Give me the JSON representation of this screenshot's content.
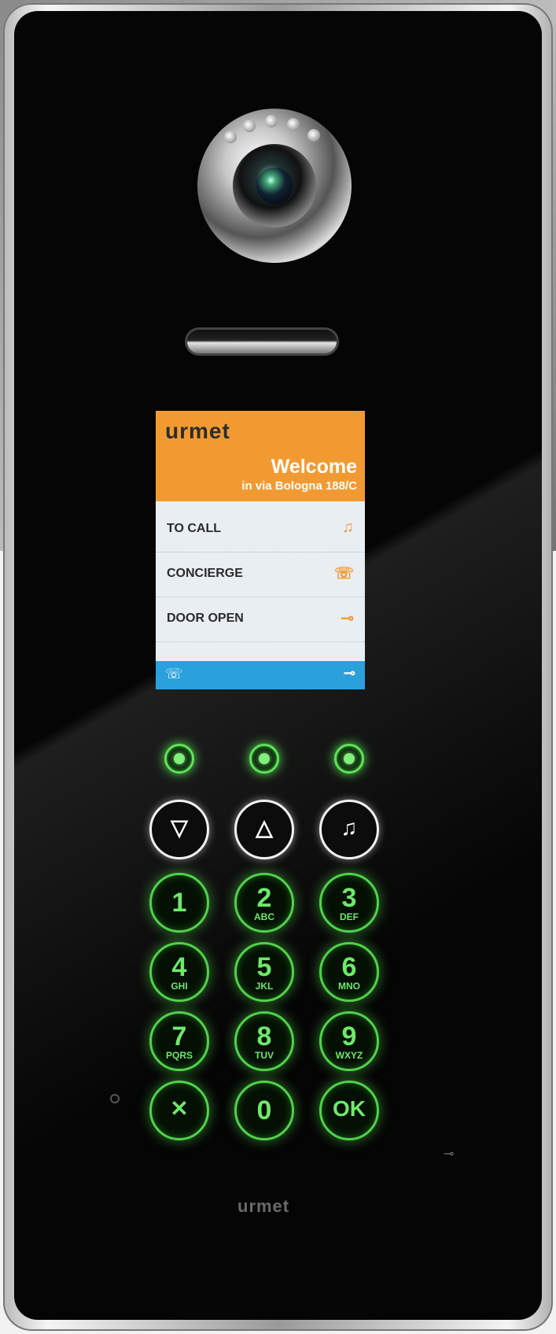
{
  "screen": {
    "brand": "urmet",
    "welcome": "Welcome",
    "address": "in via Bologna 188/C",
    "menu": [
      {
        "label": "TO CALL",
        "icon": "bell-icon",
        "glyph": "♫"
      },
      {
        "label": "CONCIERGE",
        "icon": "concierge-icon",
        "glyph": "☏"
      },
      {
        "label": "DOOR OPEN",
        "icon": "key-icon",
        "glyph": "⊸"
      }
    ],
    "footer": {
      "left_glyph": "☏",
      "right_glyph": "⊸"
    }
  },
  "keypad": {
    "nav_keys": [
      {
        "name": "down-arrow-button",
        "glyph": "▽"
      },
      {
        "name": "up-arrow-button",
        "glyph": "△"
      },
      {
        "name": "call-bell-button",
        "glyph": "♫"
      }
    ],
    "digits": [
      {
        "num": "1",
        "sub": ""
      },
      {
        "num": "2",
        "sub": "ABC"
      },
      {
        "num": "3",
        "sub": "DEF"
      },
      {
        "num": "4",
        "sub": "GHI"
      },
      {
        "num": "5",
        "sub": "JKL"
      },
      {
        "num": "6",
        "sub": "MNO"
      },
      {
        "num": "7",
        "sub": "PQRS"
      },
      {
        "num": "8",
        "sub": "TUV"
      },
      {
        "num": "9",
        "sub": "WXYZ"
      }
    ],
    "bottom_row": [
      {
        "name": "cancel-button",
        "glyph": "✕"
      },
      {
        "name": "key-0",
        "glyph": "0"
      },
      {
        "name": "ok-button",
        "glyph": "OK"
      }
    ]
  },
  "bottom_logo": "urmet",
  "colors": {
    "header": "#f29a32",
    "footer": "#2aa0dc",
    "glow": "#5fe25a"
  }
}
